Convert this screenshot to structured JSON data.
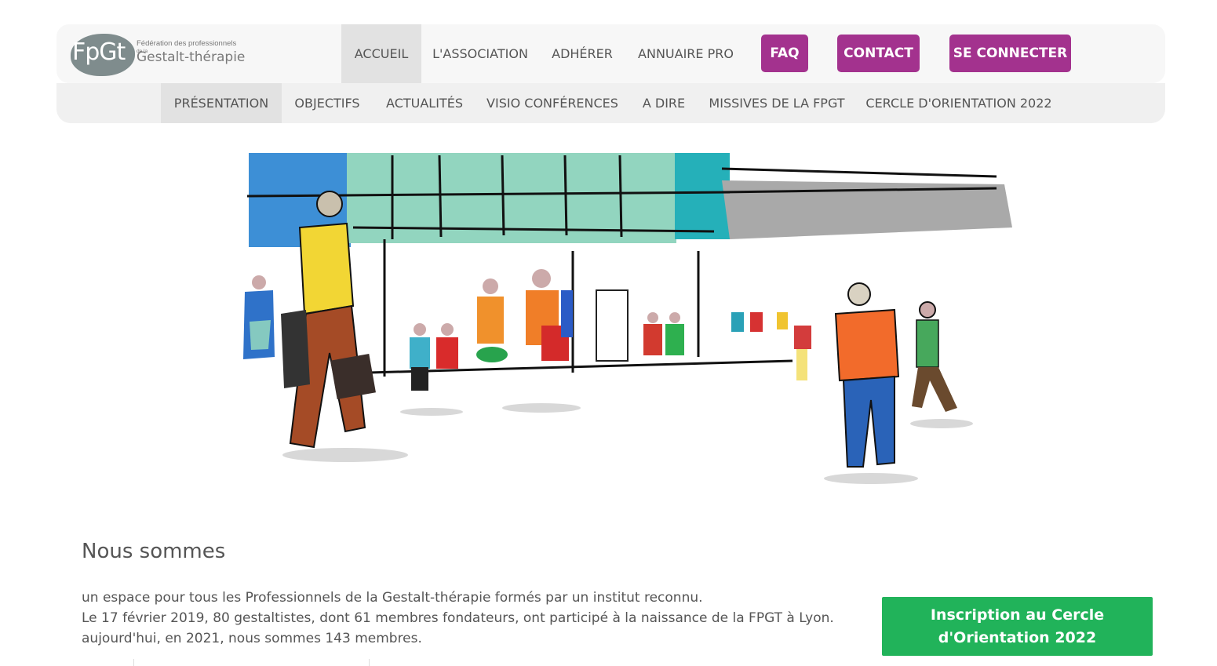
{
  "logo": {
    "mark": "FpGt",
    "line1": "Fédération des professionnels",
    "line2": "de la",
    "line3": "Gestalt-thérapie"
  },
  "main_nav": {
    "items": [
      "ACCUEIL",
      "L'ASSOCIATION",
      "ADHÉRER",
      "ANNUAIRE PRO"
    ],
    "active": "ACCUEIL",
    "buttons": [
      "FAQ",
      "CONTACT",
      "SE CONNECTER"
    ]
  },
  "sub_nav": {
    "items": [
      "PRÉSENTATION",
      "OBJECTIFS",
      "ACTUALITÉS",
      "VISIO CONFÉRENCES",
      "A DIRE",
      "MISSIVES DE LA FPGT",
      "CERCLE D'ORIENTATION 2022"
    ],
    "active": "PRÉSENTATION"
  },
  "content": {
    "heading": "Nous sommes",
    "lines": [
      "un espace pour tous les Professionnels de la Gestalt-thérapie formés par un institut reconnu.",
      "Le 17 février 2019, 80 gestaltistes, dont 61 membres fondateurs,  ont participé à la naissance de la FPGT à Lyon.",
      "aujourd'hui, en 2021,  nous sommes 143 membres."
    ],
    "cta_label": "Inscription au Cercle d'Orientation 2022"
  },
  "colors": {
    "accent_purple": "#a3328e",
    "cta_green": "#21b35a",
    "nav_bg": "#f7f7f7"
  }
}
